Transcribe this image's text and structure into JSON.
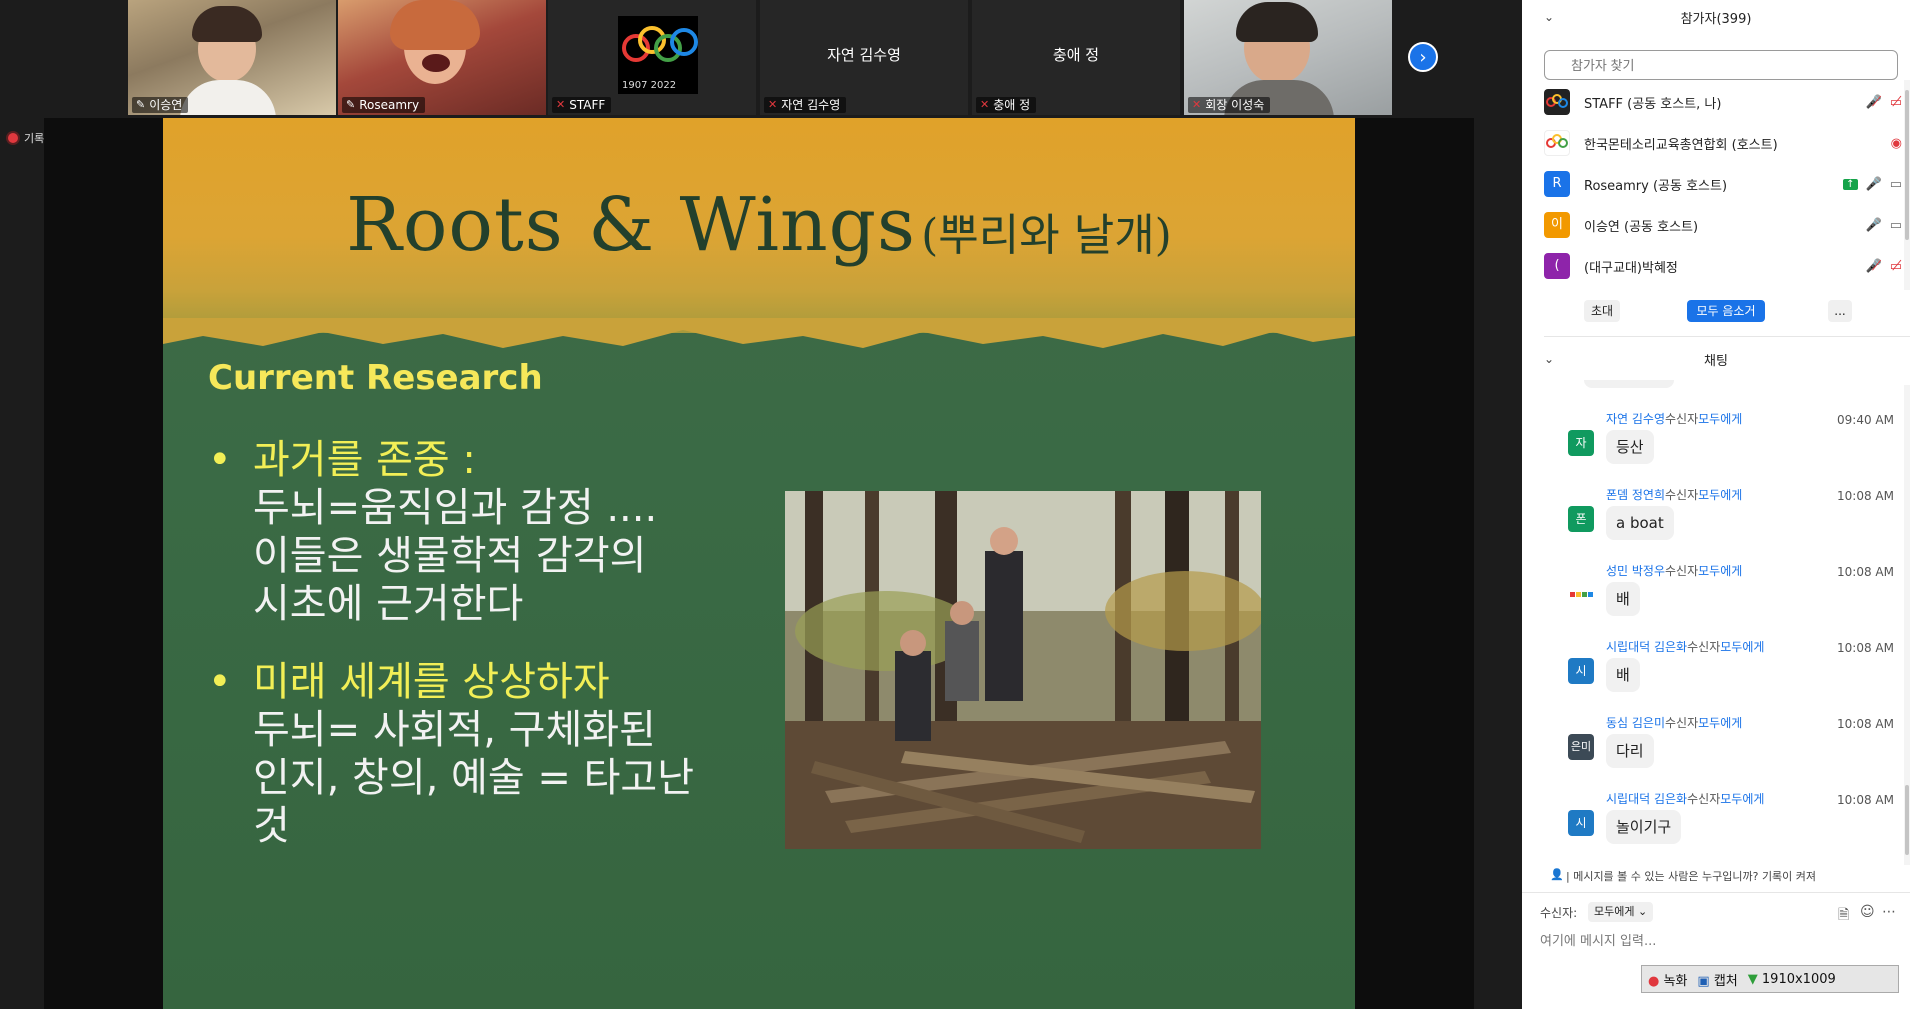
{
  "video_strip": {
    "tiles": [
      {
        "name": "이승연"
      },
      {
        "name": "Roseamry"
      },
      {
        "name": "STAFF",
        "logo_years": "1907 2022"
      },
      {
        "name": "자연 김수영",
        "center": "자연 김수영"
      },
      {
        "name": "충애 정",
        "center": "충애 정"
      },
      {
        "name": "회장 이성숙"
      }
    ]
  },
  "recording": {
    "label": "기록 중"
  },
  "slide": {
    "title_en": "Roots & Wings",
    "title_ko": "(뿌리와 날개)",
    "section": "Current Research",
    "bullets": [
      {
        "head": "과거를 존중 :",
        "lines": [
          "두뇌=움직임과 감정 ....",
          "이들은  생물학적 감각의",
          "시초에 근거한다"
        ]
      },
      {
        "head": "미래 세계를 상상하자",
        "lines": [
          "두뇌= 사회적, 구체화된",
          "인지, 창의, 예술 =  타고난",
          "것"
        ]
      }
    ]
  },
  "participants": {
    "title": "참가자(399)",
    "search_placeholder": "참가자 찾기",
    "list": [
      {
        "avatar": "",
        "name": "STAFF (공동 호스트, 나)",
        "color": "#222222"
      },
      {
        "avatar": "",
        "name": "한국몬테소리교육총연합회 (호스트)",
        "color": "#ffffff"
      },
      {
        "avatar": "R",
        "name": "Roseamry (공동 호스트)",
        "color": "#1a73e8"
      },
      {
        "avatar": "이",
        "name": "이승연 (공동 호스트)",
        "color": "#f29900"
      },
      {
        "avatar": "(",
        "name": "(대구교대)박혜정",
        "color": "#8e24aa"
      }
    ],
    "buttons": {
      "invite": "초대",
      "mute_all": "모두 음소거",
      "more": "..."
    }
  },
  "chat": {
    "title": "채팅",
    "messages": [
      {
        "avatar": "자",
        "color": "#109a5f",
        "sender": "자연 김수영",
        "to_label": "수신자",
        "to": "모두에게",
        "time": "09:40 AM",
        "text": "등산"
      },
      {
        "avatar": "폰",
        "color": "#109a5f",
        "sender": "폰뎀 정연희",
        "to_label": "수신자",
        "to": "모두에게",
        "time": "10:08 AM",
        "text": "a boat"
      },
      {
        "avatar": "",
        "color": "#ffffff",
        "sender": "성민 박정우",
        "to_label": "수신자",
        "to": "모두에게",
        "time": "10:08 AM",
        "text": "배"
      },
      {
        "avatar": "시",
        "color": "#1f7ac4",
        "sender": "시립대덕 김은화",
        "to_label": "수신자",
        "to": "모두에게",
        "time": "10:08 AM",
        "text": "배"
      },
      {
        "avatar": "은미",
        "color": "#3c4a56",
        "sender": "동심 김은미",
        "to_label": "수신자",
        "to": "모두에게",
        "time": "10:08 AM",
        "text": "다리"
      },
      {
        "avatar": "시",
        "color": "#1f7ac4",
        "sender": "시립대덕 김은화",
        "to_label": "수신자",
        "to": "모두에게",
        "time": "10:08 AM",
        "text": "놀이기구"
      }
    ],
    "notice": "| 메시지를 볼 수 있는 사람은 누구입니까? 기록이 켜져",
    "recipient_label": "수신자:",
    "recipient_value": "모두에게",
    "input_placeholder": "여기에 메시지 입력..."
  },
  "capture_bar": {
    "record": "녹화",
    "capture": "캡처",
    "size": "1910x1009"
  }
}
